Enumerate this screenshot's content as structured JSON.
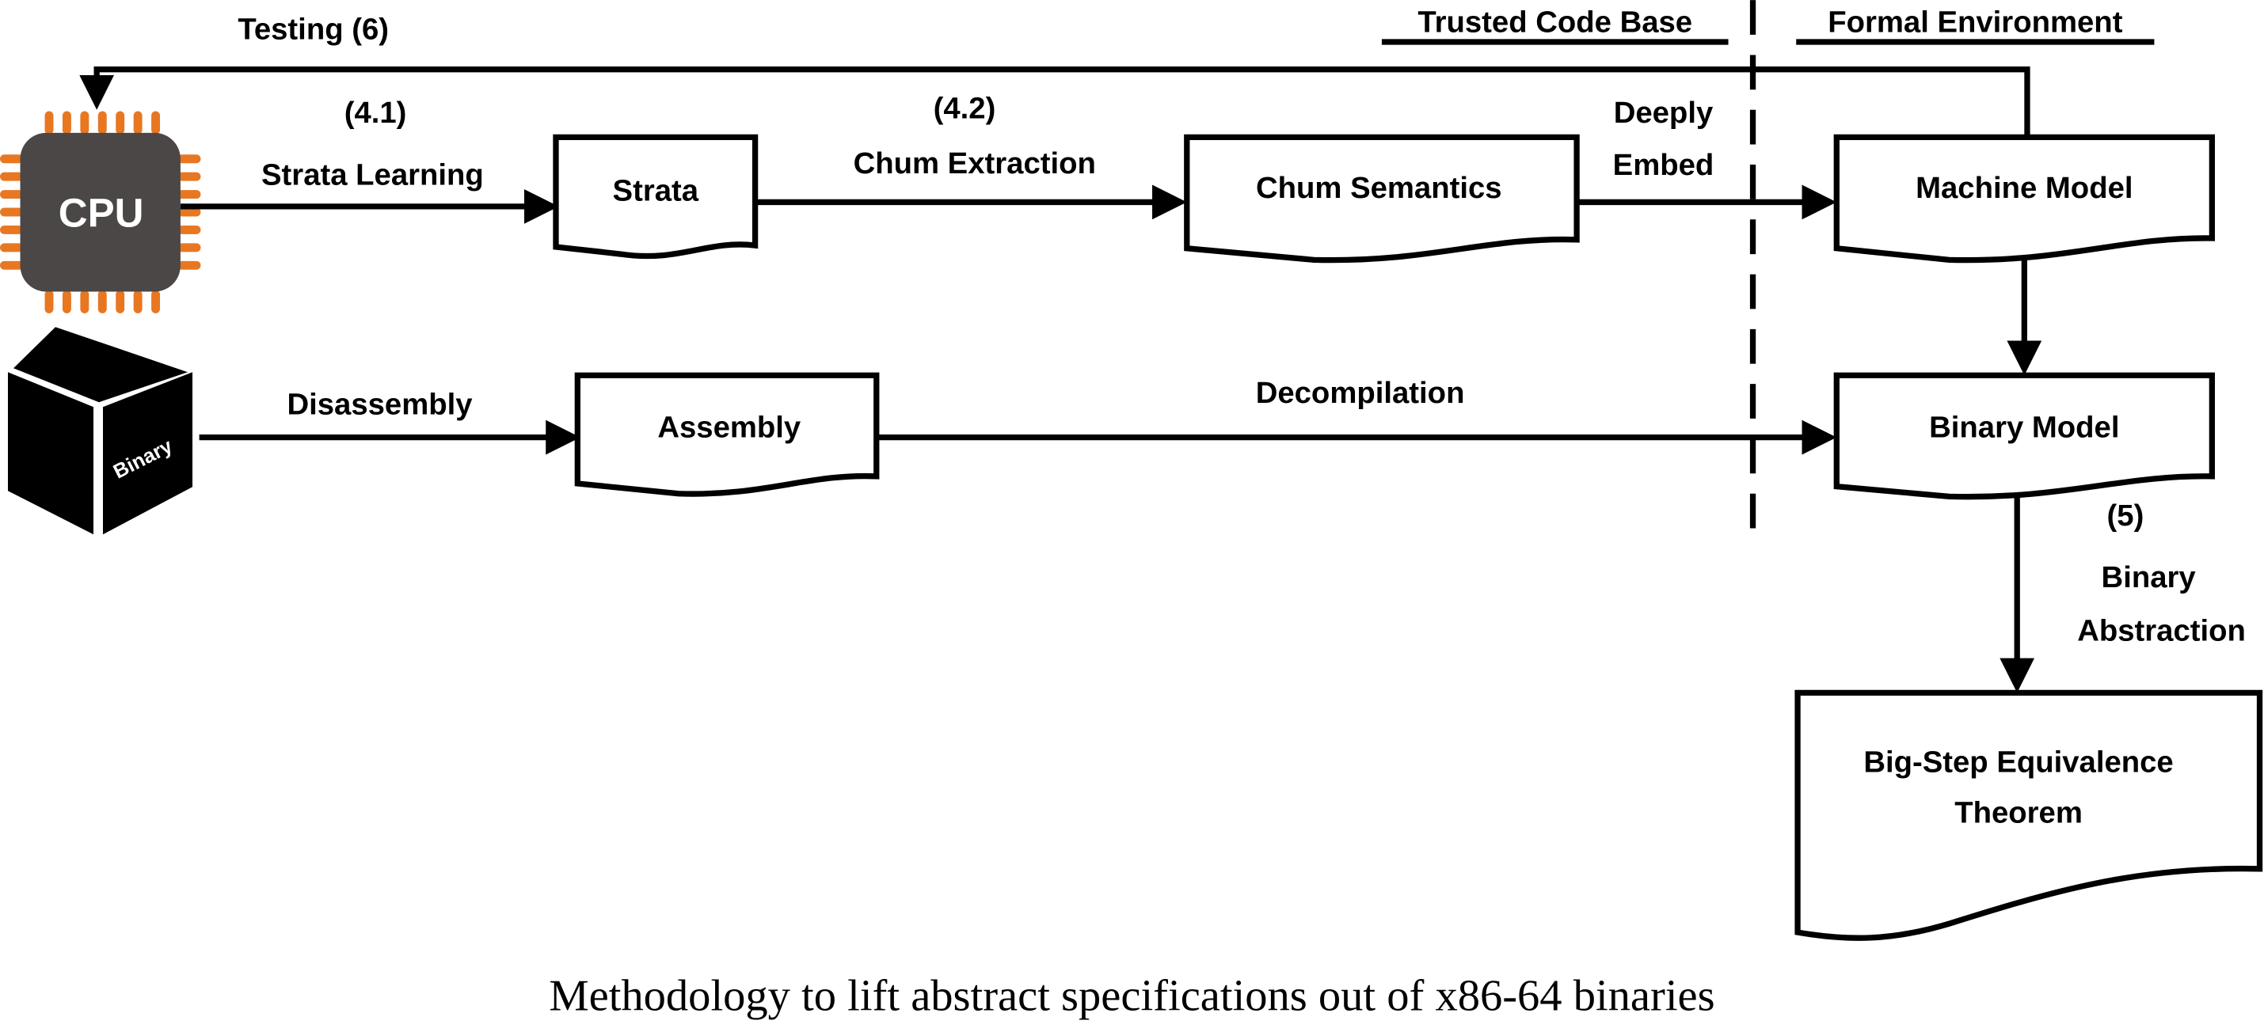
{
  "colors": {
    "cpu_body": "#4B4746",
    "cpu_pins": "#E87722",
    "cube": "#000000",
    "lines": "#000000"
  },
  "headers": {
    "trusted": "Trusted Code Base",
    "formal": "Formal Environment"
  },
  "icons": {
    "cpu": "CPU",
    "binary": "Binary"
  },
  "nodes": {
    "strata": "Strata",
    "chum_semantics": "Chum Semantics",
    "machine_model": "Machine Model",
    "assembly": "Assembly",
    "binary_model": "Binary Model",
    "theorem": [
      "Big-Step Equivalence",
      "Theorem"
    ]
  },
  "edges": {
    "testing": "Testing (6)",
    "strata_learning": [
      "(4.1)",
      "Strata Learning"
    ],
    "chum_extraction": [
      "(4.2)",
      "Chum Extraction"
    ],
    "deeply_embed": [
      "Deeply",
      "Embed"
    ],
    "disassembly": "Disassembly",
    "decompilation": "Decompilation",
    "binary_abstraction": [
      "(5)",
      "Binary",
      "Abstraction"
    ]
  },
  "caption": "Methodology to lift abstract specifications out of x86-64 binaries"
}
